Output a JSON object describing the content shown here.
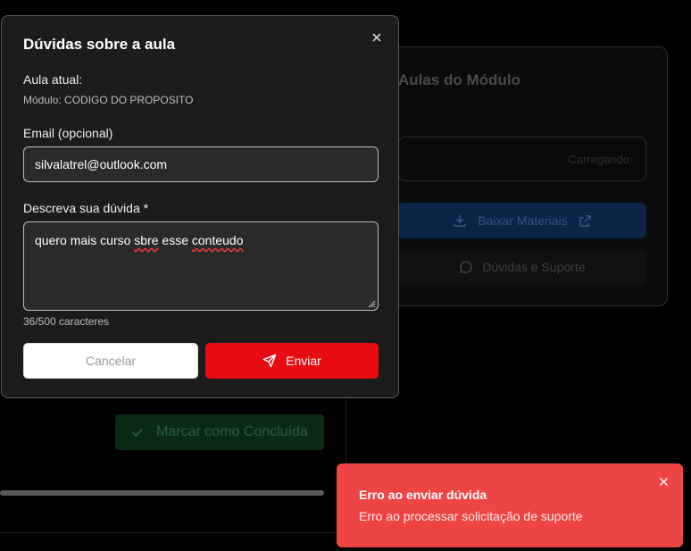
{
  "background": {
    "panel_title": "Aulas do Módulo",
    "select_text": "Carregando",
    "download_label": "Baixar Materiais",
    "support_label": "Dúvidas e Suporte",
    "complete_label": "Marcar como Concluída",
    "progress_fraction": 1.0
  },
  "modal": {
    "title": "Dúvidas sobre a aula",
    "current_lesson_label": "Aula atual:",
    "module_text": "Módulo: CODIGO DO PROPOSITO",
    "email_label": "Email (opcional)",
    "email_value": "silvalatrel@outlook.com",
    "question_label": "Descreva sua dúvida *",
    "question_words": [
      "quero",
      "mais",
      "curso",
      "sbre",
      "esse",
      "conteudo"
    ],
    "char_count": "36/500 caracteres",
    "cancel_label": "Cancelar",
    "send_label": "Enviar"
  },
  "toast": {
    "title": "Erro ao enviar dúvida",
    "message": "Erro ao processar solicitação de suporte",
    "color": "#ef4444"
  },
  "colors": {
    "accent_red": "#e60c12",
    "modal_bg": "#1c1c1c"
  }
}
